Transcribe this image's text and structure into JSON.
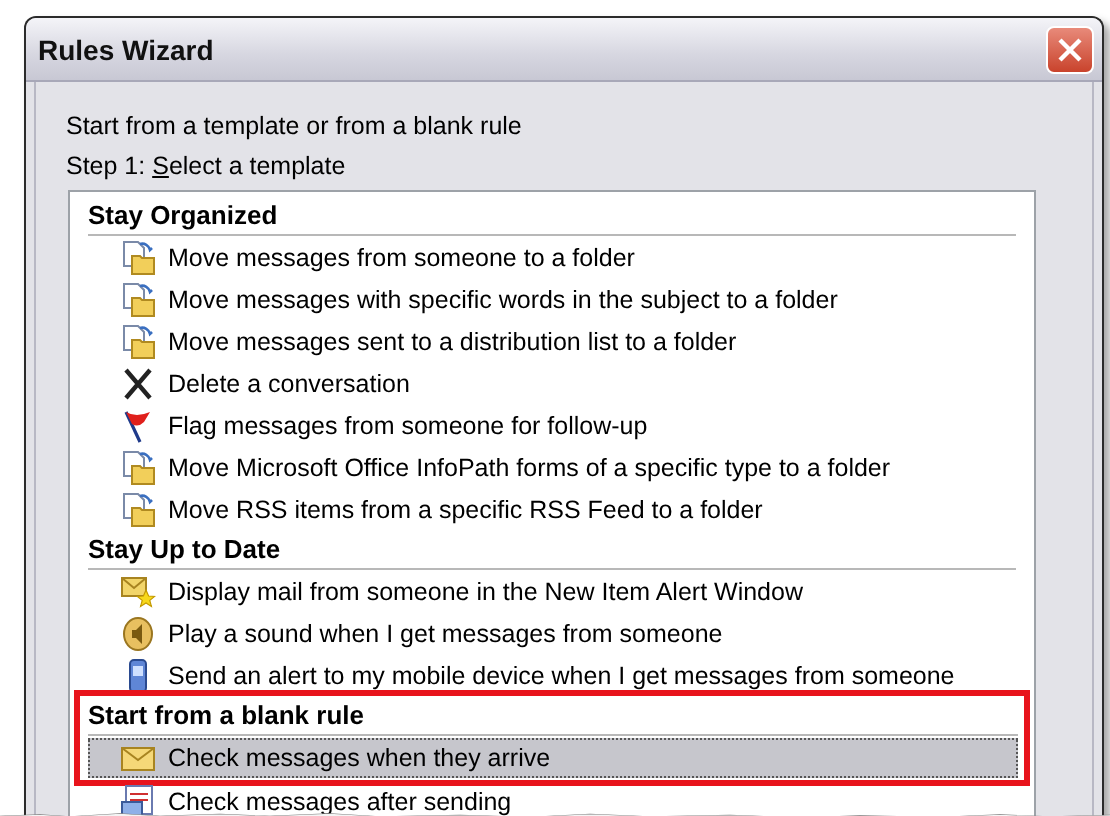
{
  "window": {
    "title": "Rules Wizard"
  },
  "intro": "Start from a template or from a blank rule",
  "step_label": {
    "before": "Step 1: ",
    "mnemonic": "S",
    "after": "elect a template"
  },
  "groups": [
    {
      "title": "Stay Organized",
      "highlighted": false,
      "items": [
        {
          "label": "Move messages from someone to a folder",
          "kind": "move",
          "selected": false
        },
        {
          "label": "Move messages with specific words in the subject to a folder",
          "kind": "move",
          "selected": false
        },
        {
          "label": "Move messages sent to a distribution list to a folder",
          "kind": "move",
          "selected": false
        },
        {
          "label": "Delete a conversation",
          "kind": "delete",
          "selected": false
        },
        {
          "label": "Flag messages from someone for follow-up",
          "kind": "flag",
          "selected": false
        },
        {
          "label": "Move Microsoft Office InfoPath forms of a specific type to a folder",
          "kind": "move",
          "selected": false
        },
        {
          "label": "Move RSS items from a specific RSS Feed to a folder",
          "kind": "move",
          "selected": false
        }
      ]
    },
    {
      "title": "Stay Up to Date",
      "highlighted": false,
      "items": [
        {
          "label": "Display mail from someone in the New Item Alert Window",
          "kind": "alert",
          "selected": false
        },
        {
          "label": "Play a sound when I get messages from someone",
          "kind": "sound",
          "selected": false
        },
        {
          "label": "Send an alert to my mobile device when I get messages from someone",
          "kind": "mobile",
          "selected": false
        }
      ]
    },
    {
      "title": "Start from a blank rule",
      "highlighted": true,
      "items": [
        {
          "label": "Check messages when they arrive",
          "kind": "mail",
          "selected": true
        },
        {
          "label": "Check messages after sending",
          "kind": "sent",
          "selected": false
        }
      ]
    }
  ]
}
